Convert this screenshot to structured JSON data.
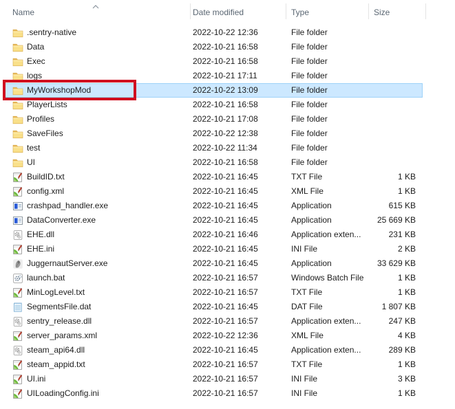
{
  "header": {
    "columns": [
      {
        "label": "Name"
      },
      {
        "label": "Date modified"
      },
      {
        "label": "Type"
      },
      {
        "label": "Size"
      }
    ],
    "sort": {
      "column": "Name",
      "direction": "ascending",
      "icon": "chevron-up-icon"
    }
  },
  "colors": {
    "selection_background": "#cce8ff",
    "selection_border": "#9ed2f8",
    "annotation_red": "#d01020",
    "header_text": "#5a6672"
  },
  "selection": {
    "selected_item": "MyWorkshopMod",
    "annotated_item": "MyWorkshopMod"
  },
  "rows": [
    {
      "name": ".sentry-native",
      "date_modified": "2022-10-22 12:36",
      "type": "File folder",
      "size": "",
      "icon": "folder-icon"
    },
    {
      "name": "Data",
      "date_modified": "2022-10-21 16:58",
      "type": "File folder",
      "size": "",
      "icon": "folder-icon"
    },
    {
      "name": "Exec",
      "date_modified": "2022-10-21 16:58",
      "type": "File folder",
      "size": "",
      "icon": "folder-icon"
    },
    {
      "name": "logs",
      "date_modified": "2022-10-21 17:11",
      "type": "File folder",
      "size": "",
      "icon": "folder-icon"
    },
    {
      "name": "MyWorkshopMod",
      "date_modified": "2022-10-22 13:09",
      "type": "File folder",
      "size": "",
      "icon": "folder-icon",
      "selected": true,
      "annotated": true
    },
    {
      "name": "PlayerLists",
      "date_modified": "2022-10-21 16:58",
      "type": "File folder",
      "size": "",
      "icon": "folder-icon"
    },
    {
      "name": "Profiles",
      "date_modified": "2022-10-21 17:08",
      "type": "File folder",
      "size": "",
      "icon": "folder-icon"
    },
    {
      "name": "SaveFiles",
      "date_modified": "2022-10-22 12:38",
      "type": "File folder",
      "size": "",
      "icon": "folder-icon"
    },
    {
      "name": "test",
      "date_modified": "2022-10-22 11:34",
      "type": "File folder",
      "size": "",
      "icon": "folder-icon"
    },
    {
      "name": "UI",
      "date_modified": "2022-10-21 16:58",
      "type": "File folder",
      "size": "",
      "icon": "folder-icon"
    },
    {
      "name": "BuildID.txt",
      "date_modified": "2022-10-21 16:45",
      "type": "TXT File",
      "size": "1 KB",
      "icon": "text-document-icon"
    },
    {
      "name": "config.xml",
      "date_modified": "2022-10-21 16:45",
      "type": "XML File",
      "size": "1 KB",
      "icon": "text-document-icon"
    },
    {
      "name": "crashpad_handler.exe",
      "date_modified": "2022-10-21 16:45",
      "type": "Application",
      "size": "615 KB",
      "icon": "application-icon"
    },
    {
      "name": "DataConverter.exe",
      "date_modified": "2022-10-21 16:45",
      "type": "Application",
      "size": "25 669 KB",
      "icon": "application-icon"
    },
    {
      "name": "EHE.dll",
      "date_modified": "2022-10-21 16:46",
      "type": "Application exten...",
      "size": "231 KB",
      "icon": "dll-gears-icon"
    },
    {
      "name": "EHE.ini",
      "date_modified": "2022-10-21 16:45",
      "type": "INI File",
      "size": "2 KB",
      "icon": "text-document-icon"
    },
    {
      "name": "JuggernautServer.exe",
      "date_modified": "2022-10-21 16:45",
      "type": "Application",
      "size": "33 629 KB",
      "icon": "juggernaut-app-icon"
    },
    {
      "name": "launch.bat",
      "date_modified": "2022-10-21 16:57",
      "type": "Windows Batch File",
      "size": "1 KB",
      "icon": "batch-gear-icon"
    },
    {
      "name": "MinLogLevel.txt",
      "date_modified": "2022-10-21 16:57",
      "type": "TXT File",
      "size": "1 KB",
      "icon": "text-document-icon"
    },
    {
      "name": "SegmentsFile.dat",
      "date_modified": "2022-10-21 16:45",
      "type": "DAT File",
      "size": "1 807 KB",
      "icon": "dat-file-icon"
    },
    {
      "name": "sentry_release.dll",
      "date_modified": "2022-10-21 16:57",
      "type": "Application exten...",
      "size": "247 KB",
      "icon": "dll-gears-icon"
    },
    {
      "name": "server_params.xml",
      "date_modified": "2022-10-22 12:36",
      "type": "XML File",
      "size": "4 KB",
      "icon": "text-document-icon"
    },
    {
      "name": "steam_api64.dll",
      "date_modified": "2022-10-21 16:45",
      "type": "Application exten...",
      "size": "289 KB",
      "icon": "dll-gears-icon"
    },
    {
      "name": "steam_appid.txt",
      "date_modified": "2022-10-21 16:57",
      "type": "TXT File",
      "size": "1 KB",
      "icon": "text-document-icon"
    },
    {
      "name": "UI.ini",
      "date_modified": "2022-10-21 16:57",
      "type": "INI File",
      "size": "3 KB",
      "icon": "text-document-icon"
    },
    {
      "name": "UILoadingConfig.ini",
      "date_modified": "2022-10-21 16:57",
      "type": "INI File",
      "size": "1 KB",
      "icon": "text-document-icon"
    }
  ]
}
